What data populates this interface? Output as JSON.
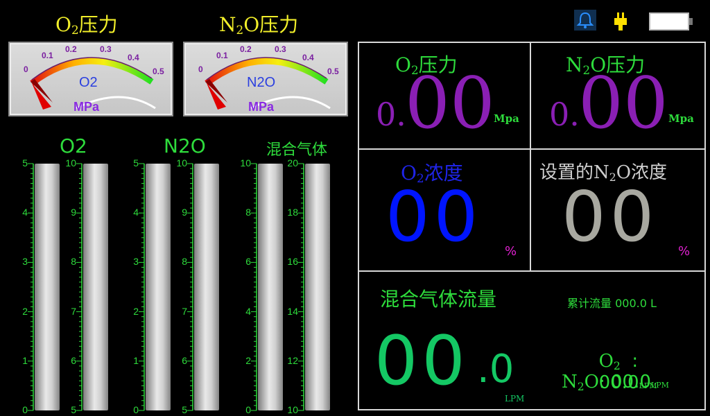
{
  "status": {
    "bell_icon": "bell-icon",
    "plug_icon": "power-plug-icon",
    "battery_icon": "battery-icon"
  },
  "gauges": [
    {
      "title_main": "O",
      "title_sub": "2",
      "title_tail": "压力",
      "label": "O2",
      "unit": "MPa",
      "ticks": [
        "0",
        "0.1",
        "0.2",
        "0.3",
        "0.4",
        "0.5"
      ],
      "value": 0.0
    },
    {
      "title_main": "N",
      "title_sub": "2",
      "title_tail": "O压力",
      "label": "N2O",
      "unit": "MPa",
      "ticks": [
        "0",
        "0.1",
        "0.2",
        "0.3",
        "0.4",
        "0.5"
      ],
      "value": 0.0
    }
  ],
  "bars": {
    "o2_label": "O2",
    "n2o_label": "N2O",
    "mix_label": "混合气体",
    "scales": [
      {
        "labels": [
          "5",
          "4",
          "3",
          "2",
          "1",
          "0"
        ]
      },
      {
        "labels": [
          "10",
          "9",
          "8",
          "7",
          "6",
          "5"
        ]
      },
      {
        "labels": [
          "5",
          "4",
          "3",
          "2",
          "1",
          "0"
        ]
      },
      {
        "labels": [
          "10",
          "9",
          "8",
          "7",
          "6",
          "5"
        ]
      },
      {
        "labels": [
          "10",
          "8",
          "6",
          "4",
          "2",
          "0"
        ]
      },
      {
        "labels": [
          "20",
          "18",
          "16",
          "14",
          "12",
          "10"
        ]
      }
    ]
  },
  "panel": {
    "o2_pressure": {
      "title_main": "O",
      "title_sub": "2",
      "title_tail": "压力",
      "small": "0.",
      "big": "00",
      "unit": "Mpa"
    },
    "n2o_pressure": {
      "title_main": "N",
      "title_sub": "2",
      "title_tail": "O压力",
      "small": "0.",
      "big": "00",
      "unit": "Mpa"
    },
    "o2_conc": {
      "title_main": "O",
      "title_sub": "2",
      "title_tail": "浓度",
      "value": "00",
      "unit": "%"
    },
    "n2o_conc": {
      "title_pre": "设置的N",
      "title_sub": "2",
      "title_tail": "O浓度",
      "value": "00",
      "unit": "%"
    },
    "mix_flow": {
      "title": "混合气体流量",
      "cumulative_label": "累计流量",
      "cumulative_value": "000.0",
      "cumulative_unit": "L",
      "value_int": "00",
      "value_dec": ".0",
      "unit": "LPM",
      "o2_main": "O",
      "o2_sub": "2",
      "o2_sep": "  :",
      "o2_value": "00.0",
      "o2_unit": "LPM",
      "n2o_main": "N",
      "n2o_sub": "2",
      "n2o_tail": "O:",
      "n2o_value": "00.0",
      "n2o_unit": "LPM"
    }
  }
}
